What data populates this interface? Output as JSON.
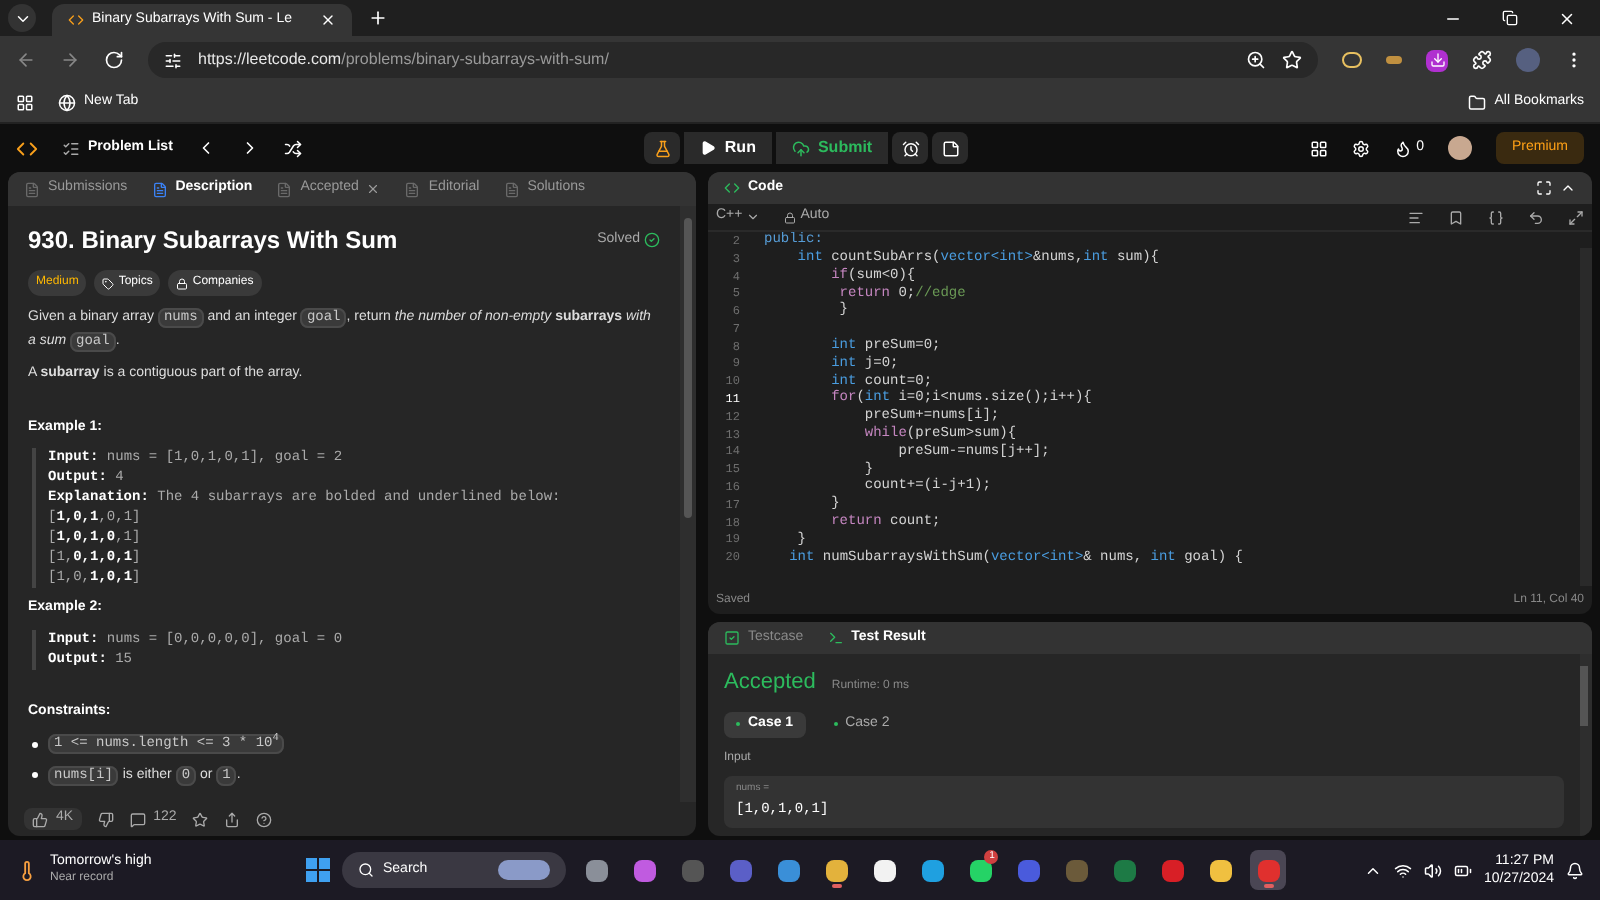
{
  "browser": {
    "tab_title": "Binary Subarrays With Sum - Le",
    "url_host": "https://leetcode.com",
    "url_path": "/problems/binary-subarrays-with-sum/",
    "bookmark": "New Tab",
    "all_bookmarks": "All Bookmarks"
  },
  "header": {
    "problem_list": "Problem List",
    "run": "Run",
    "submit": "Submit",
    "streak": "0",
    "premium": "Premium"
  },
  "left_tabs": [
    {
      "label": "Submissions",
      "selected": false,
      "closable": false
    },
    {
      "label": "Description",
      "selected": true,
      "closable": false
    },
    {
      "label": "Accepted",
      "selected": false,
      "closable": true
    },
    {
      "label": "Editorial",
      "selected": false,
      "closable": false
    },
    {
      "label": "Solutions",
      "selected": false,
      "closable": false
    }
  ],
  "problem": {
    "title": "930. Binary Subarrays With Sum",
    "status": "Solved",
    "difficulty": "Medium",
    "topics": "Topics",
    "companies": "Companies",
    "statement": [
      {
        "kind": "text",
        "text": "Given a binary array "
      },
      {
        "kind": "code",
        "text": "nums"
      },
      {
        "kind": "text",
        "text": " and an integer "
      },
      {
        "kind": "code",
        "text": "goal"
      },
      {
        "kind": "text",
        "text": ", return *the number of non-empty* **subarrays** *with a sum* "
      },
      {
        "kind": "code",
        "text": "goal"
      },
      {
        "kind": "text",
        "text": "."
      }
    ],
    "definition": "A **subarray** is a contiguous part of the array.",
    "examples": [
      {
        "heading": "Example 1:",
        "lines": [
          "**Input:** nums = [1,0,1,0,1], goal = 2",
          "**Output:** 4",
          "**Explanation:** The 4 subarrays are bolded and underlined below:",
          "[**1,0,1**,0,1]",
          "[**1,0,1,0**,1]",
          "[1,**0,1,0,1**]",
          "[1,0,**1,0,1**]"
        ]
      },
      {
        "heading": "Example 2:",
        "lines": [
          "**Input:** nums = [0,0,0,0,0], goal = 0",
          "**Output:** 15"
        ]
      }
    ],
    "constraints_heading": "Constraints:",
    "constraints": [
      [
        {
          "kind": "code",
          "text": "1 <= nums.length <= 3 * 10$^{4}$"
        }
      ],
      [
        {
          "kind": "code",
          "text": "nums[i]"
        },
        {
          "kind": "text",
          "text": " is either "
        },
        {
          "kind": "code",
          "text": "0"
        },
        {
          "kind": "text",
          "text": " or "
        },
        {
          "kind": "code",
          "text": "1"
        },
        {
          "kind": "text",
          "text": "."
        }
      ]
    ]
  },
  "footer": {
    "likes": "4K",
    "comments": "122"
  },
  "code": {
    "title": "Code",
    "language": "C++",
    "mode": "Auto",
    "saved": "Saved",
    "position": "Ln 11, Col 40",
    "lines": [
      {
        "n": "2",
        "selected": false,
        "tokens": [
          {
            "kind": "keyword",
            "text": "public:"
          }
        ]
      },
      {
        "n": "3",
        "selected": false,
        "tokens": [
          {
            "kind": "type",
            "text": "    int"
          },
          {
            "kind": "plain",
            "text": " countSubArrs("
          },
          {
            "kind": "type",
            "text": "vector<int>"
          },
          {
            "kind": "plain",
            "text": "&nums,"
          },
          {
            "kind": "type",
            "text": "int"
          },
          {
            "kind": "plain",
            "text": " sum){"
          }
        ]
      },
      {
        "n": "4",
        "selected": false,
        "tokens": [
          {
            "kind": "control",
            "text": "        if"
          },
          {
            "kind": "plain",
            "text": "(sum<0){"
          }
        ]
      },
      {
        "n": "5",
        "selected": false,
        "tokens": [
          {
            "kind": "control",
            "text": "         return"
          },
          {
            "kind": "plain",
            "text": " 0;"
          },
          {
            "kind": "comment",
            "text": "//edge"
          }
        ]
      },
      {
        "n": "6",
        "selected": false,
        "tokens": [
          {
            "kind": "plain",
            "text": "         }"
          }
        ]
      },
      {
        "n": "7",
        "selected": false
      },
      {
        "n": "8",
        "selected": false,
        "tokens": [
          {
            "kind": "type",
            "text": "        int"
          },
          {
            "kind": "plain",
            "text": " preSum=0;"
          }
        ]
      },
      {
        "n": "9",
        "selected": false,
        "tokens": [
          {
            "kind": "type",
            "text": "        int"
          },
          {
            "kind": "plain",
            "text": " j=0;"
          }
        ]
      },
      {
        "n": "10",
        "selected": false,
        "tokens": [
          {
            "kind": "type",
            "text": "        int"
          },
          {
            "kind": "plain",
            "text": " count=0;"
          }
        ]
      },
      {
        "n": "11",
        "selected": true,
        "tokens": [
          {
            "kind": "control",
            "text": "        for"
          },
          {
            "kind": "plain",
            "text": "("
          },
          {
            "kind": "type",
            "text": "int"
          },
          {
            "kind": "plain",
            "text": " i=0;i<nums.size();i++){"
          }
        ]
      },
      {
        "n": "12",
        "selected": false,
        "tokens": [
          {
            "kind": "plain",
            "text": "            preSum+=nums[i];"
          }
        ]
      },
      {
        "n": "13",
        "selected": false,
        "tokens": [
          {
            "kind": "control",
            "text": "            while"
          },
          {
            "kind": "plain",
            "text": "(preSum>sum){"
          }
        ]
      },
      {
        "n": "14",
        "selected": false,
        "tokens": [
          {
            "kind": "plain",
            "text": "                preSum-=nums[j++];"
          }
        ]
      },
      {
        "n": "15",
        "selected": false,
        "tokens": [
          {
            "kind": "plain",
            "text": "            }"
          }
        ]
      },
      {
        "n": "16",
        "selected": false,
        "tokens": [
          {
            "kind": "plain",
            "text": "            count+=(i-j+1);"
          }
        ]
      },
      {
        "n": "17",
        "selected": false,
        "tokens": [
          {
            "kind": "plain",
            "text": "        }"
          }
        ]
      },
      {
        "n": "18",
        "selected": false,
        "tokens": [
          {
            "kind": "control",
            "text": "        return"
          },
          {
            "kind": "plain",
            "text": " count;"
          }
        ]
      },
      {
        "n": "19",
        "selected": false,
        "tokens": [
          {
            "kind": "plain",
            "text": "    }"
          }
        ]
      },
      {
        "n": "20",
        "selected": false,
        "tokens": [
          {
            "kind": "type",
            "text": "   int"
          },
          {
            "kind": "plain",
            "text": " numSubarraysWithSum("
          },
          {
            "kind": "type",
            "text": "vector<int>"
          },
          {
            "kind": "plain",
            "text": "& nums, "
          },
          {
            "kind": "type",
            "text": "int"
          },
          {
            "kind": "plain",
            "text": " goal) {"
          }
        ]
      }
    ]
  },
  "result": {
    "tabs": [
      {
        "label": "Testcase",
        "selected": false
      },
      {
        "label": "Test Result",
        "selected": true
      }
    ],
    "verdict": "Accepted",
    "runtime": "Runtime: 0 ms",
    "cases": [
      {
        "label": "Case 1",
        "selected": true
      },
      {
        "label": "Case 2",
        "selected": false
      }
    ],
    "input_label": "Input",
    "param_name": "nums =",
    "param_value": "[1,0,1,0,1]"
  },
  "taskbar": {
    "weather_title": "Tomorrow's high",
    "weather_note": "Near record",
    "search": "Search",
    "apps": [
      {
        "color": "#8a8f99",
        "running": false,
        "selected": false
      },
      {
        "color": "#c05be0",
        "running": false,
        "selected": false
      },
      {
        "color": "#555555",
        "running": false,
        "selected": false
      },
      {
        "color": "#5b5fc7",
        "running": false,
        "selected": false
      },
      {
        "color": "#3a8fd8",
        "running": false,
        "selected": false
      },
      {
        "color": "#e3b23c",
        "running": true,
        "selected": false
      },
      {
        "color": "#f2f2f2",
        "running": false,
        "selected": false
      },
      {
        "color": "#1fa0e0",
        "running": false,
        "selected": false
      },
      {
        "color": "#25d366",
        "running": false,
        "selected": false,
        "badge": "1"
      },
      {
        "color": "#4a5bdc",
        "running": false,
        "selected": false
      },
      {
        "color": "#6b5a3a",
        "running": false,
        "selected": false
      },
      {
        "color": "#1d7a45",
        "running": false,
        "selected": false
      },
      {
        "color": "#d81f26",
        "running": false,
        "selected": false
      },
      {
        "color": "#f0c040",
        "running": false,
        "selected": false
      },
      {
        "color": "#e0302e",
        "running": true,
        "selected": true
      }
    ],
    "time": "11:27 PM",
    "date": "10/27/2024"
  }
}
